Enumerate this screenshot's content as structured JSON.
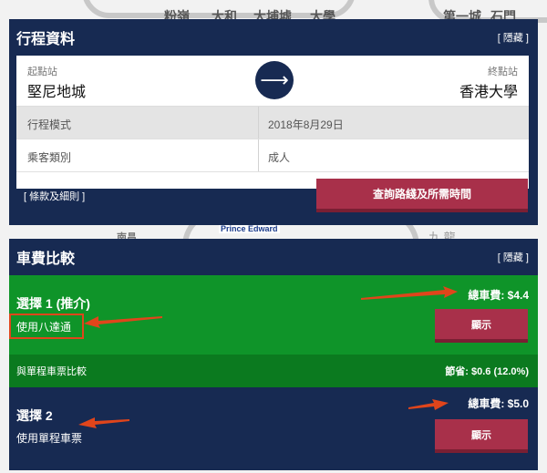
{
  "map": {
    "labels_top": [
      "粉嶺",
      "大和",
      "大埔墟",
      "大學",
      "第一城",
      "石門"
    ],
    "prince_edward": "Prince Edward",
    "left_fragment": "南昌",
    "kowloon": "九 龍"
  },
  "trip": {
    "title": "行程資料",
    "hide": "[ 隱藏 ]",
    "from_label": "起點站",
    "from_name": "堅尼地城",
    "to_label": "終點站",
    "to_name": "香港大學",
    "arrow": "⟶",
    "mode_label": "行程模式",
    "date": "2018年8月29日",
    "passenger_label": "乘客類別",
    "passenger": "成人",
    "terms": "[ 條款及細則 ]",
    "query_button": "查詢路綫及所需時間"
  },
  "fare": {
    "title": "車費比較",
    "hide": "[ 隱藏 ]",
    "option1": {
      "title": "選擇 1 (推介)",
      "method": "使用八達通",
      "total": "總車費: $4.4",
      "show": "顯示"
    },
    "compare": {
      "label": "與單程車票比較",
      "saving": "節省: $0.6 (12.0%)"
    },
    "option2": {
      "title": "選擇 2",
      "method": "使用單程車票",
      "total": "總車費: $5.0",
      "show": "顯示"
    }
  },
  "colors": {
    "panel": "#172a52",
    "green": "#0f9429",
    "dark_green": "#0b7a1f",
    "button": "#a8304a",
    "annotation": "#e0451b"
  }
}
